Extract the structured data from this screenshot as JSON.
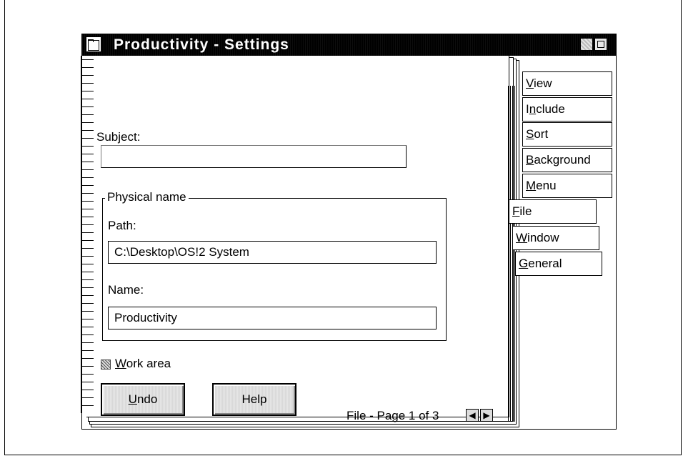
{
  "window": {
    "title": "Productivity - Settings"
  },
  "tabs": {
    "view": "View",
    "include": "Include",
    "sort": "Sort",
    "background": "Background",
    "menu": "Menu",
    "file": "File",
    "window": "Window",
    "general": "General",
    "active": "File"
  },
  "form": {
    "subject_label": "Subject:",
    "subject_value": "",
    "physical_name_label": "Physical name",
    "path_label": "Path:",
    "path_value": "C:\\Desktop\\OS!2 System",
    "name_label": "Name:",
    "name_value": "Productivity",
    "work_area_label": "Work area",
    "work_area_checked": "mixed"
  },
  "buttons": {
    "undo": "Undo",
    "help": "Help"
  },
  "footer": {
    "page_info": "File - Page 1 of 3"
  },
  "icons": {
    "system_menu": "system-menu-icon",
    "minimize": "minimize-icon",
    "maximize": "maximize-icon",
    "prev_page": "arrow-left-icon",
    "next_page": "arrow-right-icon"
  }
}
